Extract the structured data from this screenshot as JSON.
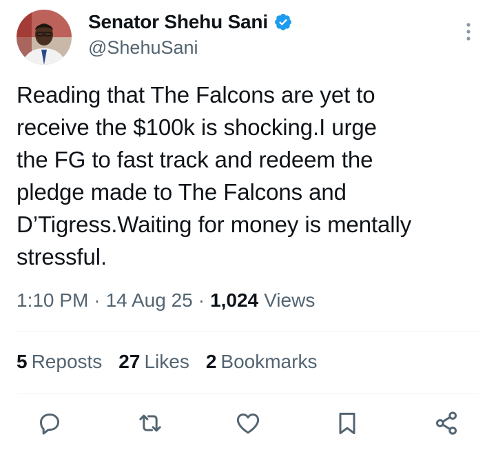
{
  "author": {
    "display_name": "Senator Shehu Sani",
    "handle": "@ShehuSani",
    "verified": true
  },
  "tweet": {
    "text": "Reading that The Falcons are yet to\nreceive the $100k is shocking.I urge\nthe FG to fast track and redeem the\npledge made to The Falcons and\nD’Tigress.Waiting for money is mentally\nstressful."
  },
  "meta": {
    "time": "1:10 PM",
    "separator": "·",
    "date": "14 Aug 25",
    "views_count": "1,024",
    "views_label": "Views"
  },
  "stats": {
    "reposts_count": "5",
    "reposts_label": "Reposts",
    "likes_count": "27",
    "likes_label": "Likes",
    "bookmarks_count": "2",
    "bookmarks_label": "Bookmarks"
  },
  "icons": {
    "verified": "verified-badge-icon",
    "more": "more-vertical-icon",
    "reply": "reply-icon",
    "repost": "repost-icon",
    "like": "heart-icon",
    "bookmark": "bookmark-icon",
    "share": "share-icon"
  },
  "colors": {
    "text_primary": "#0f1419",
    "text_secondary": "#536471",
    "verified_blue": "#1d9bf0",
    "divider": "#eff3f4"
  }
}
